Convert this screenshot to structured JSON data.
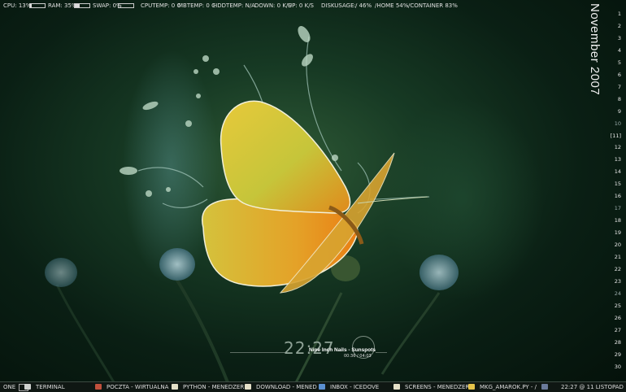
{
  "topbar": {
    "cpu_label": "CPU: 13%",
    "cpu_level": 0.13,
    "ram_label": "RAM: 35%",
    "ram_level": 0.35,
    "swap_label": "SWAP: 0%",
    "swap_level": 0.0,
    "cputemp": "CPUTEMP: 0 C",
    "mbtemp": "MBTEMP: 0 C",
    "hddtemp": "HDDTEMP: N/A",
    "down": "DOWN: 0 K/S",
    "up": "UP: 0 K/S",
    "diskusage": "DISKUSAGE:",
    "root_usage": "/ 46%",
    "home_usage": "/HOME 54%",
    "container_usage": "/CONTAINER 83%"
  },
  "calendar": {
    "month": "November 2007",
    "days": [
      "1",
      "2",
      "3",
      "4",
      "5",
      "6",
      "7",
      "8",
      "9",
      "10",
      "[11]",
      "12",
      "13",
      "14",
      "15",
      "16",
      "17",
      "18",
      "19",
      "20",
      "21",
      "22",
      "23",
      "24",
      "25",
      "26",
      "27",
      "28",
      "29",
      "30"
    ],
    "today": "[11]"
  },
  "clock": {
    "time": "22:27",
    "track": "Nine Inch Nails - Sunspots",
    "position": "00:36 / 04:03"
  },
  "taskbar": {
    "desktop": "ONE",
    "tasks": [
      {
        "label": "TERMINAL",
        "icon": "terminal-icon"
      },
      {
        "label": "POCZTA - WIRTUALNA",
        "icon": "browser-icon"
      },
      {
        "label": "PYTHON - MENEDZER",
        "icon": "folder-icon"
      },
      {
        "label": "DOWNLOAD - MENED",
        "icon": "folder-icon"
      },
      {
        "label": "INBOX - ICEDOVE",
        "icon": "mail-icon"
      },
      {
        "label": "SCREENS - MENEDZER",
        "icon": "folder-icon"
      },
      {
        "label": "MKG_AMAROK.PY - /",
        "icon": "editor-icon"
      }
    ],
    "clock": "22:27 @ 11 LISTOPAD"
  }
}
